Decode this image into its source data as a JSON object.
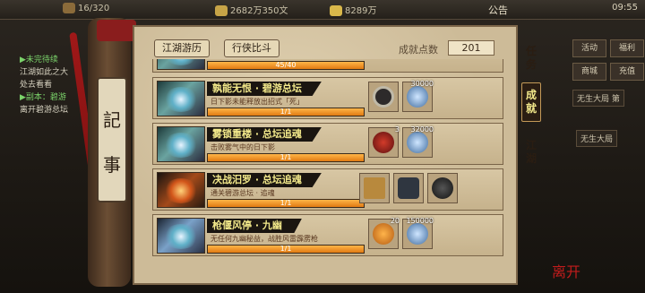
{
  "topbar": {
    "res1": "16/320",
    "res2": "2682万350文",
    "res3": "8289万",
    "notice": "公告",
    "clock": "09:55"
  },
  "sidequest": {
    "line1": "▶未完待续",
    "line2": "江湖如此之大",
    "line3": "处去看看",
    "line4": "▶副本：碧游",
    "line5": "离开碧游总坛"
  },
  "right_panel": {
    "btn1": "活动",
    "btn2": "福利",
    "btn3": "商城",
    "btn4": "充值",
    "info1": "无生大局 第",
    "info2": "无生大局"
  },
  "record": {
    "ch1": "記",
    "ch2": "事"
  },
  "tabs": {
    "tab1": "江湖游历",
    "tab2": "行侠比斗"
  },
  "achievement": {
    "label": "成就点数",
    "value": "201"
  },
  "side_tabs": {
    "t1": "任务",
    "t2": "成就",
    "t3": "江湖"
  },
  "quests": [
    {
      "title": "",
      "desc": "",
      "progress_text": "45/40",
      "progress": 1.0
    },
    {
      "title": "孰能无恨 · 碧游总坛",
      "desc": "日下影未能释放出招式「死」",
      "progress_text": "1/1",
      "progress": 1.0,
      "rewards": [
        {
          "icon": "belt-icon",
          "count": ""
        },
        {
          "icon": "coin-icon",
          "count": "30000"
        }
      ]
    },
    {
      "title": "雾锁重楼 · 总坛追魂",
      "desc": "击败雾气中的日下影",
      "progress_text": "1/1",
      "progress": 1.0,
      "rewards": [
        {
          "icon": "hood-icon",
          "count": "3"
        },
        {
          "icon": "coin-icon",
          "count": "32000"
        }
      ]
    },
    {
      "title": "决战汨罗 · 总坛追魂",
      "desc": "通关碧游总坛 · 追魂",
      "progress_text": "1/1",
      "progress": 1.0,
      "rewards": [
        {
          "icon": "book-icon",
          "count": ""
        },
        {
          "icon": "gauntlet-icon",
          "count": ""
        },
        {
          "icon": "hood-icon",
          "count": ""
        }
      ]
    },
    {
      "title": "枪偃风停 · 九幽",
      "desc": "无任何九幽秘益，战胜风雷霹雳枪",
      "progress_text": "1/1",
      "progress": 1.0,
      "rewards": [
        {
          "icon": "treasure-icon",
          "count": "20"
        },
        {
          "icon": "coin-icon",
          "count": "150000"
        }
      ]
    }
  ],
  "seal": "离开"
}
